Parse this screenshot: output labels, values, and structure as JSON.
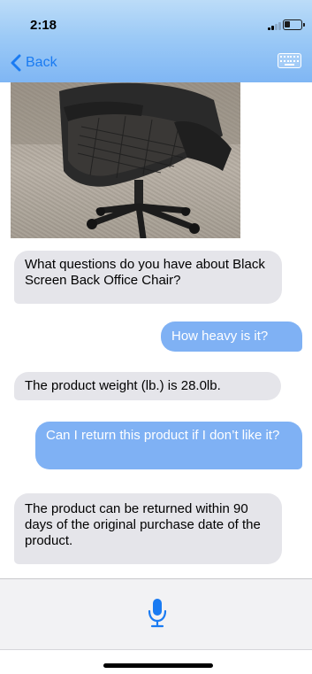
{
  "status_bar": {
    "time": "2:18"
  },
  "nav": {
    "back_label": "Back",
    "keyboard_icon": "keyboard-icon"
  },
  "product": {
    "image_icon": "office-chair-photo"
  },
  "messages": [
    {
      "sender": "bot",
      "text": "What questions do you have about Black Screen Back Office Chair?"
    },
    {
      "sender": "user",
      "text": "How heavy is it?"
    },
    {
      "sender": "bot",
      "text": "The product weight (lb.) is 28.0lb."
    },
    {
      "sender": "user",
      "text": "Can I return this product if I don’t like it?"
    },
    {
      "sender": "bot",
      "text": "The product can be returned within 90 days of the original purchase date of the product."
    }
  ],
  "input": {
    "mic_icon": "microphone-icon"
  },
  "colors": {
    "accent": "#1a7bf2",
    "user_bubble": "#7fb1f4",
    "bot_bubble": "#e5e5ea",
    "header_top": "#bcdcf8",
    "header_bottom": "#7fb6f4"
  }
}
